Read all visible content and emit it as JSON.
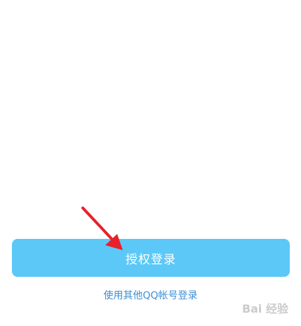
{
  "login": {
    "authorize_label": "授权登录",
    "other_account_label": "使用其他QQ帐号登录"
  },
  "colors": {
    "button_bg": "#5bc8f8",
    "link": "#3d8fd6",
    "arrow": "#e8202a"
  },
  "watermark": {
    "text": "Bai 经验",
    "icon": "paw-icon"
  }
}
